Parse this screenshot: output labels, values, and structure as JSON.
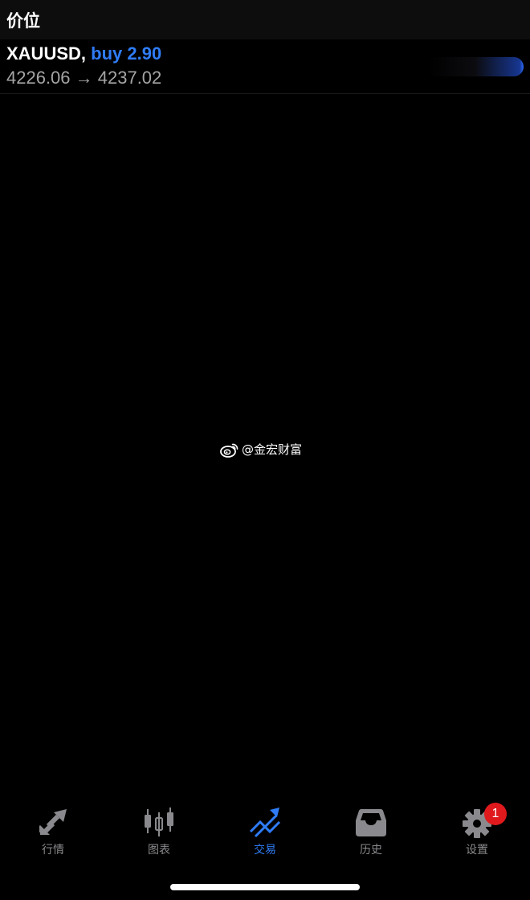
{
  "section": {
    "title": "价位"
  },
  "position": {
    "symbol": "XAUUSD,",
    "side_volume": "buy 2.90",
    "price_range": "4226.06 → 4237.02"
  },
  "watermark": {
    "logo": "weibo-logo",
    "text": "@金宏财富"
  },
  "tabbar": {
    "tabs": [
      {
        "label": "行情",
        "icon": "quotes-arrows-icon"
      },
      {
        "label": "图表",
        "icon": "candlestick-chart-icon"
      },
      {
        "label": "交易",
        "icon": "trade-trend-icon",
        "active": true
      },
      {
        "label": "历史",
        "icon": "history-tray-icon"
      },
      {
        "label": "设置",
        "icon": "settings-gear-icon",
        "badge": "1"
      }
    ]
  },
  "colors": {
    "accent": "#2f7cf6",
    "inactive": "#8a8a8e",
    "badge": "#e0191d",
    "background": "#000000"
  }
}
